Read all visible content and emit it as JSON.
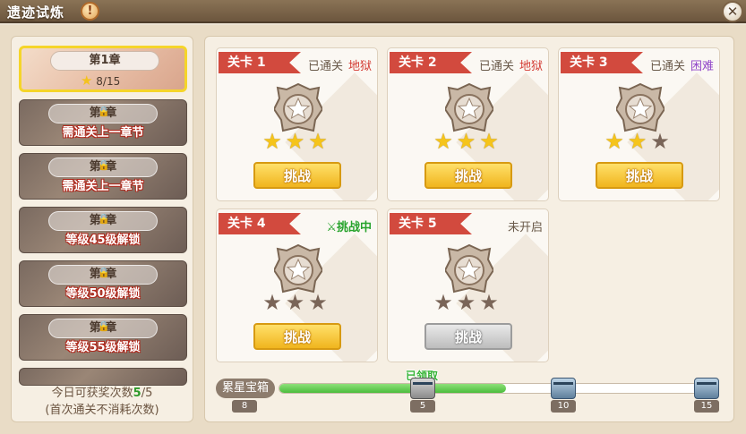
{
  "window": {
    "title": "遗迹试炼"
  },
  "chapters": [
    {
      "label": "第1章",
      "stars": "8/15",
      "active": true
    },
    {
      "label": "第  章",
      "lock_text": "需通关上一章节"
    },
    {
      "label": "第  章",
      "lock_text": "需通关上一章节"
    },
    {
      "label": "第  章",
      "lock_text": "等级45级解锁"
    },
    {
      "label": "第  章",
      "lock_text": "等级50级解锁"
    },
    {
      "label": "第  章",
      "lock_text": "等级55级解锁"
    }
  ],
  "reward": {
    "line1_prefix": "今日可获奖次数",
    "current": "5",
    "line1_suffix": "/5",
    "line2": "(首次通关不消耗次数)"
  },
  "stages": [
    {
      "tag": "关卡 1",
      "status": "已通关",
      "difficulty": "地狱",
      "stars_earned": 3,
      "button": "挑战"
    },
    {
      "tag": "关卡 2",
      "status": "已通关",
      "difficulty": "地狱",
      "stars_earned": 3,
      "button": "挑战"
    },
    {
      "tag": "关卡 3",
      "status": "已通关",
      "difficulty": "困难",
      "stars_earned": 2,
      "button": "挑战"
    },
    {
      "tag": "关卡 4",
      "status": "挑战中",
      "stars_earned": 0,
      "button": "挑战"
    },
    {
      "tag": "关卡 5",
      "status": "未开启",
      "stars_earned": 0,
      "button": "挑战"
    }
  ],
  "star_box": {
    "label": "累星宝箱",
    "current": "8",
    "claimed_label": "已领取",
    "milestones": [
      "5",
      "10",
      "15"
    ],
    "progress_fraction": 0.53
  },
  "colors": {
    "accent": "#f5d52a",
    "hell": "#d33a32",
    "hard": "#9146c9",
    "ongoing": "#27a32c"
  }
}
